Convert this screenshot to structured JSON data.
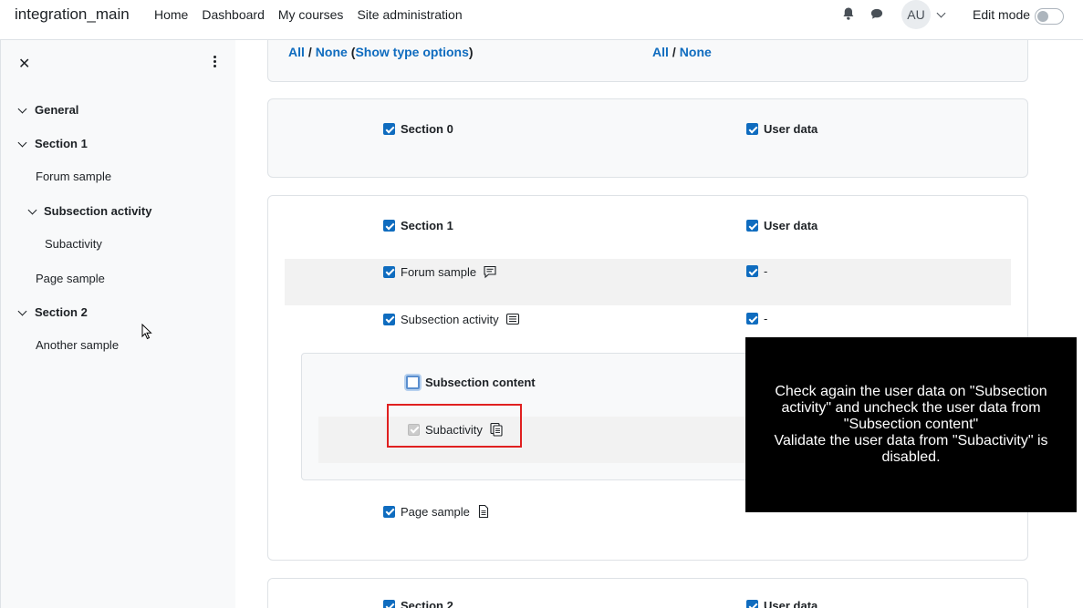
{
  "navbar": {
    "brand": "integration_main",
    "links": [
      "Home",
      "Dashboard",
      "My courses",
      "Site administration"
    ],
    "avatar_initials": "AU",
    "edit_mode_label": "Edit mode"
  },
  "drawer": {
    "close": "✕",
    "items": [
      {
        "label": "General"
      },
      {
        "label": "Section 1"
      },
      {
        "label": "Forum sample"
      },
      {
        "label": "Subsection activity"
      },
      {
        "label": "Subactivity"
      },
      {
        "label": "Page sample"
      },
      {
        "label": "Section 2"
      },
      {
        "label": "Another sample"
      }
    ]
  },
  "type_options": {
    "all": "All",
    "slash": "/",
    "none": "None",
    "open_paren": "(",
    "show": "Show type options",
    "close_paren": ")",
    "all2": "All",
    "none2": "None"
  },
  "sections": {
    "s0": {
      "label": "Section 0",
      "userdata": "User data"
    },
    "s1": {
      "label": "Section 1",
      "userdata": "User data"
    },
    "forum": {
      "label": "Forum sample",
      "userdata": "-"
    },
    "subsection": {
      "label": "Subsection activity",
      "userdata": "-"
    },
    "subcontent": {
      "label": "Subsection content"
    },
    "subactivity": {
      "label": "Subactivity"
    },
    "page": {
      "label": "Page sample"
    },
    "s2": {
      "label": "Section 2",
      "userdata": "User data"
    }
  },
  "overlay": {
    "line1": "Check again  the user data on \"Subsection activity\" and uncheck the user data from \"Subsection content\"",
    "line2": "Validate the user data from \"Subactivity\" is disabled."
  },
  "colors": {
    "link": "#0f6cbf",
    "highlight": "#e02020"
  }
}
